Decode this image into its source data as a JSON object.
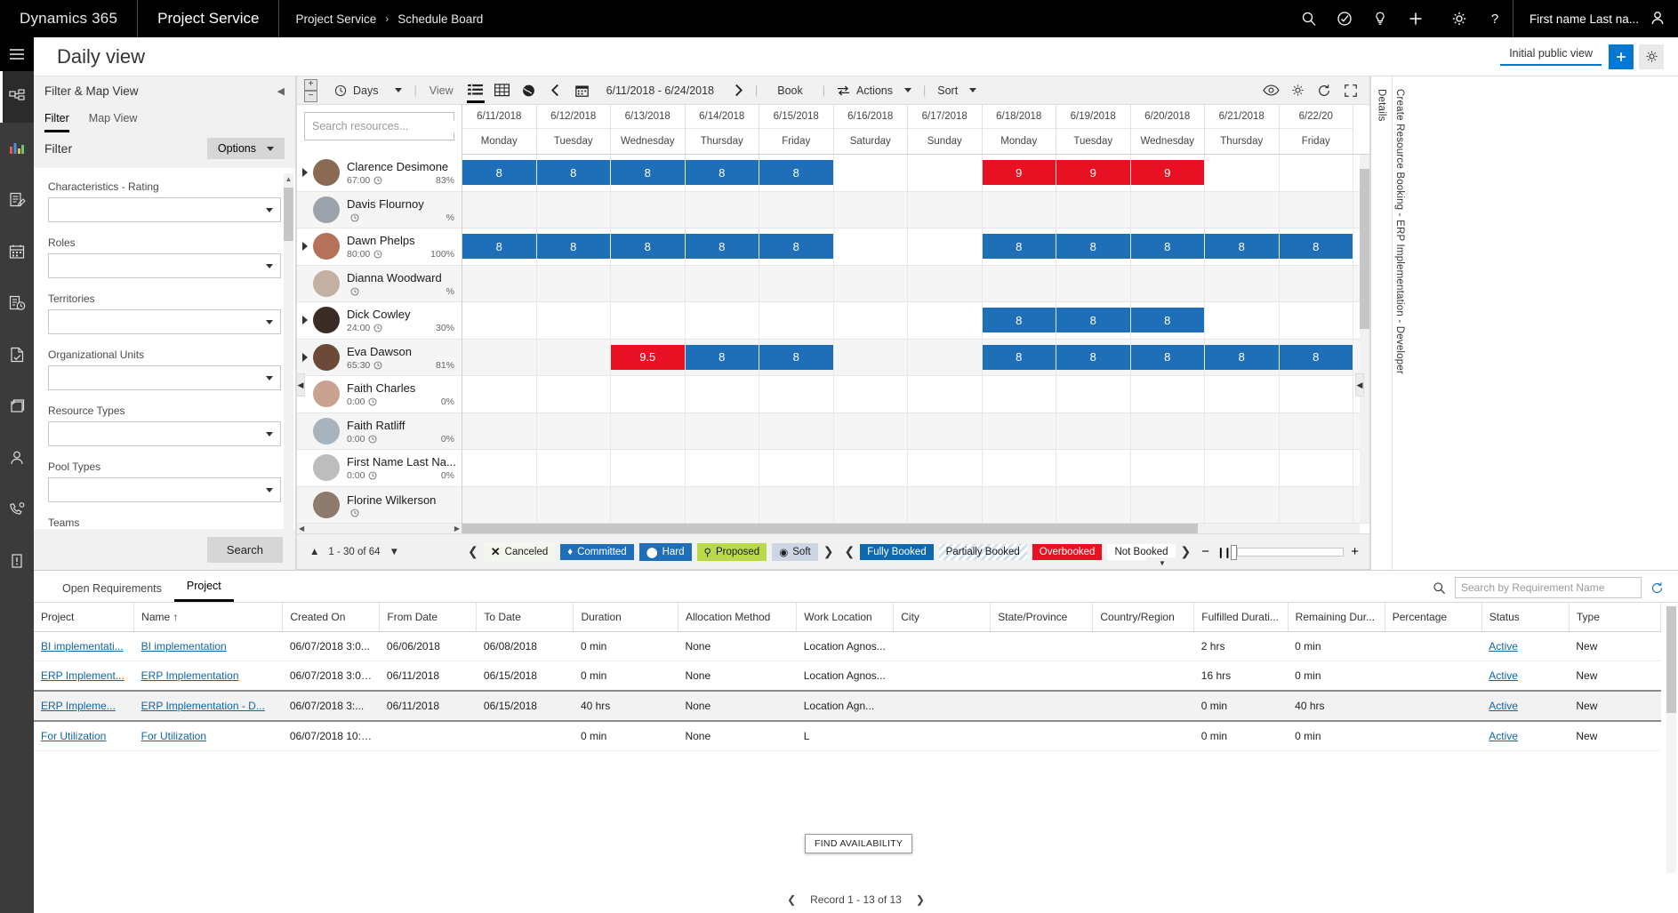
{
  "topbar": {
    "brand": "Dynamics 365",
    "app": "Project Service",
    "breadcrumb_parent": "Project Service",
    "breadcrumb_sep": "›",
    "breadcrumb_current": "Schedule Board",
    "user": "First name Last na...",
    "icons": [
      "search-icon",
      "assistant-icon",
      "insights-icon",
      "plus-icon",
      "gear-icon",
      "help-icon",
      "user-avatar-icon"
    ]
  },
  "page": {
    "title": "Daily view",
    "view_name": "Initial public view",
    "add_label": "+",
    "settings_label": "⚙"
  },
  "filter_panel": {
    "title": "Filter & Map View",
    "tabs": [
      {
        "label": "Filter",
        "active": true
      },
      {
        "label": "Map View",
        "active": false
      }
    ],
    "section_label": "Filter",
    "options_label": "Options",
    "fields": [
      {
        "label": "Characteristics - Rating",
        "value": ""
      },
      {
        "label": "Roles",
        "value": ""
      },
      {
        "label": "Territories",
        "value": ""
      },
      {
        "label": "Organizational Units",
        "value": ""
      },
      {
        "label": "Resource Types",
        "value": ""
      },
      {
        "label": "Pool Types",
        "value": ""
      },
      {
        "label": "Teams",
        "value": ""
      }
    ],
    "search_button": "Search"
  },
  "board": {
    "toolbar": {
      "scale_label": "Days",
      "view_label": "View",
      "date_range": "6/11/2018 - 6/24/2018",
      "book_label": "Book",
      "actions_label": "Actions",
      "sort_label": "Sort"
    },
    "resource_search_placeholder": "Search resources...",
    "columns": [
      {
        "date": "6/11/2018",
        "day": "Monday"
      },
      {
        "date": "6/12/2018",
        "day": "Tuesday"
      },
      {
        "date": "6/13/2018",
        "day": "Wednesday"
      },
      {
        "date": "6/14/2018",
        "day": "Thursday"
      },
      {
        "date": "6/15/2018",
        "day": "Friday"
      },
      {
        "date": "6/16/2018",
        "day": "Saturday"
      },
      {
        "date": "6/17/2018",
        "day": "Sunday"
      },
      {
        "date": "6/18/2018",
        "day": "Monday"
      },
      {
        "date": "6/19/2018",
        "day": "Tuesday"
      },
      {
        "date": "6/20/2018",
        "day": "Wednesday"
      },
      {
        "date": "6/21/2018",
        "day": "Thursday"
      },
      {
        "date": "6/22/20",
        "day": "Friday"
      }
    ],
    "resources": [
      {
        "name": "Clarence Desimone",
        "hours": "67:00",
        "pct": "83%",
        "expandable": true,
        "cells": [
          {
            "v": "8",
            "s": "blue"
          },
          {
            "v": "8",
            "s": "blue"
          },
          {
            "v": "8",
            "s": "blue"
          },
          {
            "v": "8",
            "s": "blue"
          },
          {
            "v": "8",
            "s": "blue"
          },
          {
            "v": "",
            "s": ""
          },
          {
            "v": "",
            "s": ""
          },
          {
            "v": "9",
            "s": "red"
          },
          {
            "v": "9",
            "s": "red"
          },
          {
            "v": "9",
            "s": "red"
          },
          {
            "v": "",
            "s": ""
          },
          {
            "v": "",
            "s": ""
          }
        ]
      },
      {
        "name": "Davis Flournoy",
        "hours": "",
        "pct": "%",
        "expandable": false,
        "cells": [
          {
            "v": "",
            "s": ""
          },
          {
            "v": "",
            "s": ""
          },
          {
            "v": "",
            "s": ""
          },
          {
            "v": "",
            "s": ""
          },
          {
            "v": "",
            "s": ""
          },
          {
            "v": "",
            "s": ""
          },
          {
            "v": "",
            "s": ""
          },
          {
            "v": "",
            "s": ""
          },
          {
            "v": "",
            "s": ""
          },
          {
            "v": "",
            "s": ""
          },
          {
            "v": "",
            "s": ""
          },
          {
            "v": "",
            "s": ""
          }
        ]
      },
      {
        "name": "Dawn Phelps",
        "hours": "80:00",
        "pct": "100%",
        "expandable": true,
        "cells": [
          {
            "v": "8",
            "s": "blue"
          },
          {
            "v": "8",
            "s": "blue"
          },
          {
            "v": "8",
            "s": "blue"
          },
          {
            "v": "8",
            "s": "blue"
          },
          {
            "v": "8",
            "s": "blue"
          },
          {
            "v": "",
            "s": ""
          },
          {
            "v": "",
            "s": ""
          },
          {
            "v": "8",
            "s": "blue"
          },
          {
            "v": "8",
            "s": "blue"
          },
          {
            "v": "8",
            "s": "blue"
          },
          {
            "v": "8",
            "s": "blue"
          },
          {
            "v": "8",
            "s": "blue"
          }
        ]
      },
      {
        "name": "Dianna Woodward",
        "hours": "",
        "pct": "%",
        "expandable": false,
        "cells": [
          {
            "v": "",
            "s": ""
          },
          {
            "v": "",
            "s": ""
          },
          {
            "v": "",
            "s": ""
          },
          {
            "v": "",
            "s": ""
          },
          {
            "v": "",
            "s": ""
          },
          {
            "v": "",
            "s": ""
          },
          {
            "v": "",
            "s": ""
          },
          {
            "v": "",
            "s": ""
          },
          {
            "v": "",
            "s": ""
          },
          {
            "v": "",
            "s": ""
          },
          {
            "v": "",
            "s": ""
          },
          {
            "v": "",
            "s": ""
          }
        ]
      },
      {
        "name": "Dick Cowley",
        "hours": "24:00",
        "pct": "30%",
        "expandable": true,
        "cells": [
          {
            "v": "",
            "s": ""
          },
          {
            "v": "",
            "s": ""
          },
          {
            "v": "",
            "s": ""
          },
          {
            "v": "",
            "s": ""
          },
          {
            "v": "",
            "s": ""
          },
          {
            "v": "",
            "s": ""
          },
          {
            "v": "",
            "s": ""
          },
          {
            "v": "8",
            "s": "blue"
          },
          {
            "v": "8",
            "s": "blue"
          },
          {
            "v": "8",
            "s": "blue"
          },
          {
            "v": "",
            "s": ""
          },
          {
            "v": "",
            "s": ""
          }
        ]
      },
      {
        "name": "Eva Dawson",
        "hours": "65:30",
        "pct": "81%",
        "expandable": true,
        "cells": [
          {
            "v": "",
            "s": ""
          },
          {
            "v": "",
            "s": ""
          },
          {
            "v": "9.5",
            "s": "red"
          },
          {
            "v": "8",
            "s": "blue"
          },
          {
            "v": "8",
            "s": "blue"
          },
          {
            "v": "",
            "s": ""
          },
          {
            "v": "",
            "s": ""
          },
          {
            "v": "8",
            "s": "blue"
          },
          {
            "v": "8",
            "s": "blue"
          },
          {
            "v": "8",
            "s": "blue"
          },
          {
            "v": "8",
            "s": "blue"
          },
          {
            "v": "8",
            "s": "blue"
          }
        ]
      },
      {
        "name": "Faith Charles",
        "hours": "0:00",
        "pct": "0%",
        "expandable": false,
        "cells": [
          {
            "v": "",
            "s": ""
          },
          {
            "v": "",
            "s": ""
          },
          {
            "v": "",
            "s": ""
          },
          {
            "v": "",
            "s": ""
          },
          {
            "v": "",
            "s": ""
          },
          {
            "v": "",
            "s": ""
          },
          {
            "v": "",
            "s": ""
          },
          {
            "v": "",
            "s": ""
          },
          {
            "v": "",
            "s": ""
          },
          {
            "v": "",
            "s": ""
          },
          {
            "v": "",
            "s": ""
          },
          {
            "v": "",
            "s": ""
          }
        ]
      },
      {
        "name": "Faith Ratliff",
        "hours": "0:00",
        "pct": "0%",
        "expandable": false,
        "cells": [
          {
            "v": "",
            "s": ""
          },
          {
            "v": "",
            "s": ""
          },
          {
            "v": "",
            "s": ""
          },
          {
            "v": "",
            "s": ""
          },
          {
            "v": "",
            "s": ""
          },
          {
            "v": "",
            "s": ""
          },
          {
            "v": "",
            "s": ""
          },
          {
            "v": "",
            "s": ""
          },
          {
            "v": "",
            "s": ""
          },
          {
            "v": "",
            "s": ""
          },
          {
            "v": "",
            "s": ""
          },
          {
            "v": "",
            "s": ""
          }
        ]
      },
      {
        "name": "First Name Last Na...",
        "hours": "0:00",
        "pct": "0%",
        "expandable": false,
        "cells": [
          {
            "v": "",
            "s": ""
          },
          {
            "v": "",
            "s": ""
          },
          {
            "v": "",
            "s": ""
          },
          {
            "v": "",
            "s": ""
          },
          {
            "v": "",
            "s": ""
          },
          {
            "v": "",
            "s": ""
          },
          {
            "v": "",
            "s": ""
          },
          {
            "v": "",
            "s": ""
          },
          {
            "v": "",
            "s": ""
          },
          {
            "v": "",
            "s": ""
          },
          {
            "v": "",
            "s": ""
          },
          {
            "v": "",
            "s": ""
          }
        ]
      },
      {
        "name": "Florine Wilkerson",
        "hours": "",
        "pct": "",
        "expandable": false,
        "cells": [
          {
            "v": "",
            "s": ""
          },
          {
            "v": "",
            "s": ""
          },
          {
            "v": "",
            "s": ""
          },
          {
            "v": "",
            "s": ""
          },
          {
            "v": "",
            "s": ""
          },
          {
            "v": "",
            "s": ""
          },
          {
            "v": "",
            "s": ""
          },
          {
            "v": "",
            "s": ""
          },
          {
            "v": "",
            "s": ""
          },
          {
            "v": "",
            "s": ""
          },
          {
            "v": "",
            "s": ""
          },
          {
            "v": "",
            "s": ""
          }
        ]
      }
    ],
    "pagination": "1 - 30 of 64",
    "legend_booking": [
      {
        "label": "Canceled",
        "cls": "cancel",
        "glyph": "✕"
      },
      {
        "label": "Committed",
        "cls": "committed",
        "glyph": "◆"
      },
      {
        "label": "Hard",
        "cls": "hard",
        "glyph": "⬤"
      },
      {
        "label": "Proposed",
        "cls": "proposed",
        "glyph": "○"
      },
      {
        "label": "Soft",
        "cls": "soft",
        "glyph": "◉"
      }
    ],
    "legend_capacity": [
      {
        "label": "Fully Booked",
        "cls": "fully"
      },
      {
        "label": "Partially Booked",
        "cls": "partial"
      },
      {
        "label": "Overbooked",
        "cls": "over"
      },
      {
        "label": "Not Booked",
        "cls": "not"
      }
    ]
  },
  "right_strip": {
    "details_label": "Details",
    "vertical_title": "Create Resource Booking - ERP Implementation - Developer"
  },
  "bottom": {
    "tabs": [
      {
        "label": "Open Requirements",
        "active": false
      },
      {
        "label": "Project",
        "active": true
      }
    ],
    "search_placeholder": "Search by Requirement Name",
    "columns": [
      "Project",
      "Name ↑",
      "Created On",
      "From Date",
      "To Date",
      "Duration",
      "Allocation Method",
      "Work Location",
      "City",
      "State/Province",
      "Country/Region",
      "Fulfilled Durati...",
      "Remaining Dur...",
      "Percentage",
      "Status",
      "Type"
    ],
    "rows": [
      {
        "selected": false,
        "cells": [
          "BI implementati...",
          "BI implementation",
          "06/07/2018 3:0...",
          "06/06/2018",
          "06/08/2018",
          "0 min",
          "None",
          "Location Agnos...",
          "",
          "",
          "",
          "2 hrs",
          "0 min",
          "",
          "Active",
          "New"
        ]
      },
      {
        "selected": false,
        "cells": [
          "ERP Implement...",
          "ERP Implementation",
          "06/07/2018 3:01...",
          "06/11/2018",
          "06/15/2018",
          "0 min",
          "None",
          "Location Agnos...",
          "",
          "",
          "",
          "16 hrs",
          "0 min",
          "",
          "Active",
          "New"
        ]
      },
      {
        "selected": true,
        "cells": [
          "ERP Impleme...",
          "ERP Implementation - D...",
          "06/07/2018 3:...",
          "06/11/2018",
          "06/15/2018",
          "40 hrs",
          "None",
          "Location Agn...",
          "",
          "",
          "",
          "0 min",
          "40 hrs",
          "",
          "Active",
          "New"
        ]
      },
      {
        "selected": false,
        "cells": [
          "For Utilization",
          "For Utilization",
          "06/07/2018 10:3...",
          "",
          "",
          "0 min",
          "None",
          "L",
          "",
          "",
          "",
          "0 min",
          "0 min",
          "",
          "Active",
          "New"
        ]
      }
    ],
    "record_info": "Record 1 - 13 of 13",
    "tooltip": "FIND AVAILABILITY"
  },
  "colors": {
    "accent": "#0078d4",
    "booked_blue": "#1e6fb8",
    "overbooked_red": "#e81123",
    "proposed_green": "#b8d94a",
    "topbar_black": "#000000",
    "rail_gray": "#3b3b3b"
  }
}
